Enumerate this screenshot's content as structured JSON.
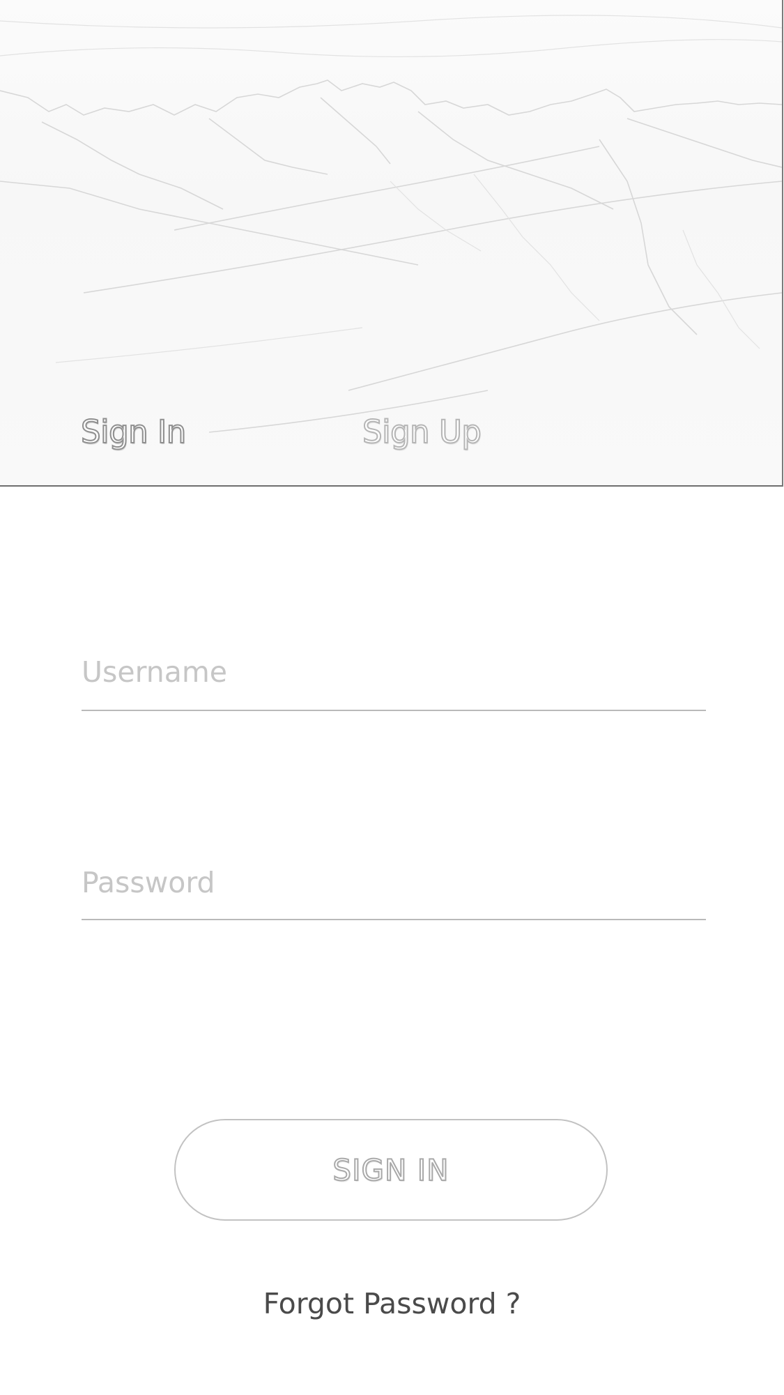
{
  "tabs": {
    "sign_in": "Sign In",
    "sign_up": "Sign Up",
    "active": "sign_in"
  },
  "form": {
    "username": {
      "placeholder": "Username",
      "value": ""
    },
    "password": {
      "placeholder": "Password",
      "value": ""
    }
  },
  "actions": {
    "sign_in_button": "SIGN IN",
    "forgot_password": "Forgot Password ?"
  },
  "colors": {
    "background": "#ffffff",
    "hero_border": "#6e6e6e",
    "field_underline": "#b9b9b9",
    "placeholder": "#c6c6c6",
    "link_text": "#4a4a4a"
  },
  "icons": {
    "hero_image": "mountain-landscape-sketch"
  }
}
